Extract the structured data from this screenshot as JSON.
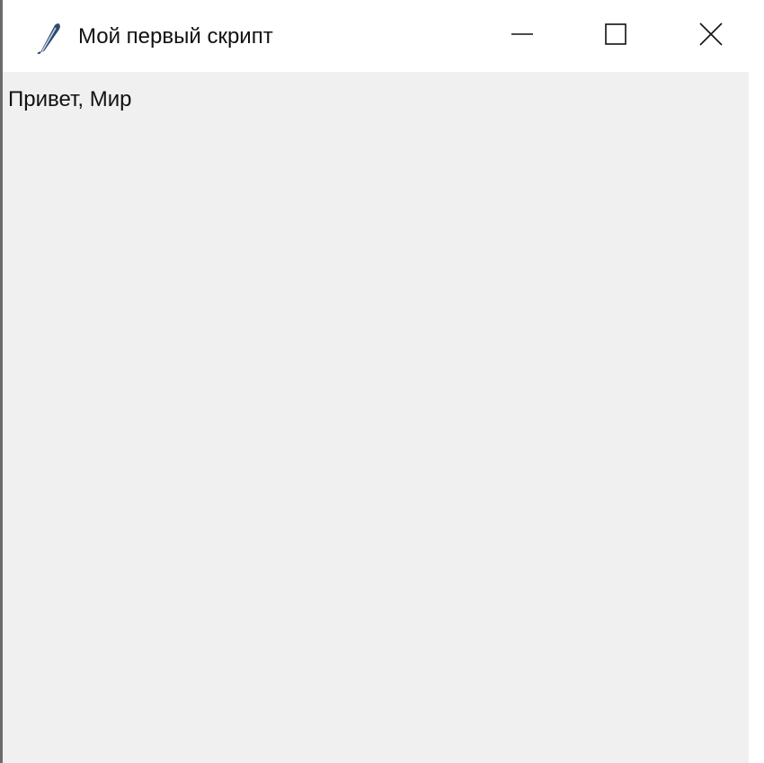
{
  "window": {
    "title": "Мой первый скрипт",
    "icon": "feather-icon",
    "controls": {
      "minimize_icon": "minimize-icon",
      "maximize_icon": "maximize-icon",
      "close_icon": "close-icon"
    }
  },
  "content": {
    "label": "Привет, Мир"
  },
  "colors": {
    "titlebar_bg": "#ffffff",
    "client_bg": "#f0f0f0",
    "text": "#111111"
  }
}
